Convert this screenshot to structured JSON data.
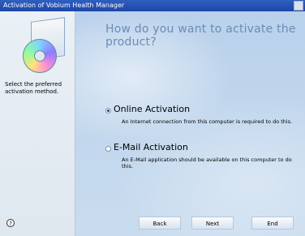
{
  "window": {
    "title": "Activation of Vobium Health Manager"
  },
  "left_panel": {
    "instruction": "Select the preferred activation method."
  },
  "main": {
    "heading": "How do you want to activate the product?",
    "options": [
      {
        "title": "Online Activation",
        "description": "An Internet connection from this computer is required to do this.",
        "selected": true
      },
      {
        "title": "E-Mail Activation",
        "description": "An E-Mail application should be available on this computer to do this.",
        "selected": false
      }
    ]
  },
  "footer": {
    "help_symbol": "?",
    "buttons": {
      "back": "Back",
      "next": "Next",
      "end": "End"
    }
  }
}
